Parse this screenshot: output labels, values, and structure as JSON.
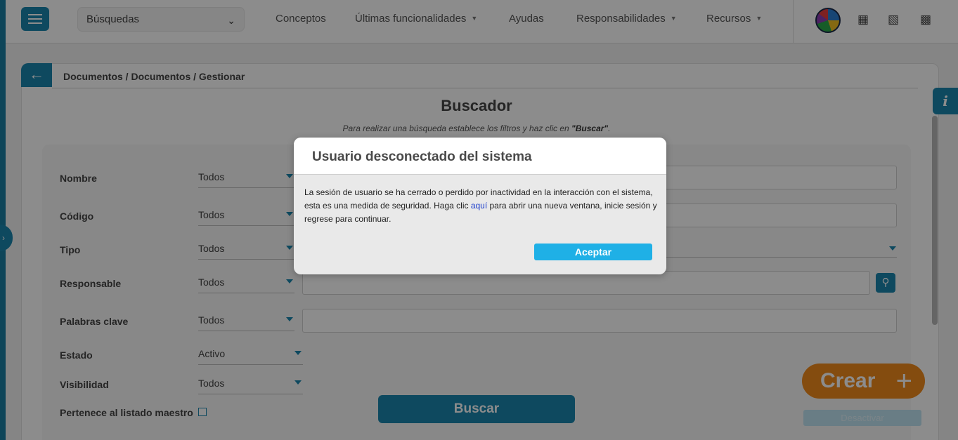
{
  "topbar": {
    "search_select": "Búsquedas",
    "nav": [
      {
        "label": "Conceptos"
      },
      {
        "label": "Últimas funcionalidades"
      },
      {
        "label": "Ayudas"
      },
      {
        "label": "Responsabilidades"
      },
      {
        "label": "Recursos"
      }
    ],
    "icons": [
      "menu-icon",
      "calendar-icon",
      "library-icon",
      "monitor-icon"
    ]
  },
  "breadcrumb": "Documentos / Documentos / Gestionar",
  "page": {
    "title": "Buscador",
    "subtitle_prefix": "Para realizar una búsqueda establece los filtros y haz clic en ",
    "subtitle_emphasis": "\"Buscar\"",
    "subtitle_suffix": "."
  },
  "filters": {
    "nombre": {
      "label": "Nombre",
      "value": "Todos"
    },
    "codigo": {
      "label": "Código",
      "value": "Todos"
    },
    "tipo": {
      "label": "Tipo",
      "value": "Todos"
    },
    "responsable": {
      "label": "Responsable",
      "value": "Todos"
    },
    "palabras": {
      "label": "Palabras clave",
      "value": "Todos"
    },
    "estado": {
      "label": "Estado",
      "value": "Activo"
    },
    "visibilidad": {
      "label": "Visibilidad",
      "value": "Todos"
    },
    "listado": {
      "label": "Pertenece al listado maestro",
      "checked": false
    }
  },
  "buttons": {
    "buscar": "Buscar",
    "crear": "Crear",
    "desactivar": "Desactivar"
  },
  "dialog": {
    "title": "Usuario desconectado del sistema",
    "message_part1": "La sesión de usuario se ha cerrado o perdido por inactividad en la interacción con el sistema, esta es una medida de seguridad. Haga clic ",
    "link": "aquí",
    "message_part2": " para abrir una nueva ventana, inicie sesión y regrese para continuar.",
    "accept": "Aceptar"
  },
  "colors": {
    "primary": "#1b86ad",
    "accent": "#f08a1c",
    "dialog_button": "#1fb0e6"
  }
}
